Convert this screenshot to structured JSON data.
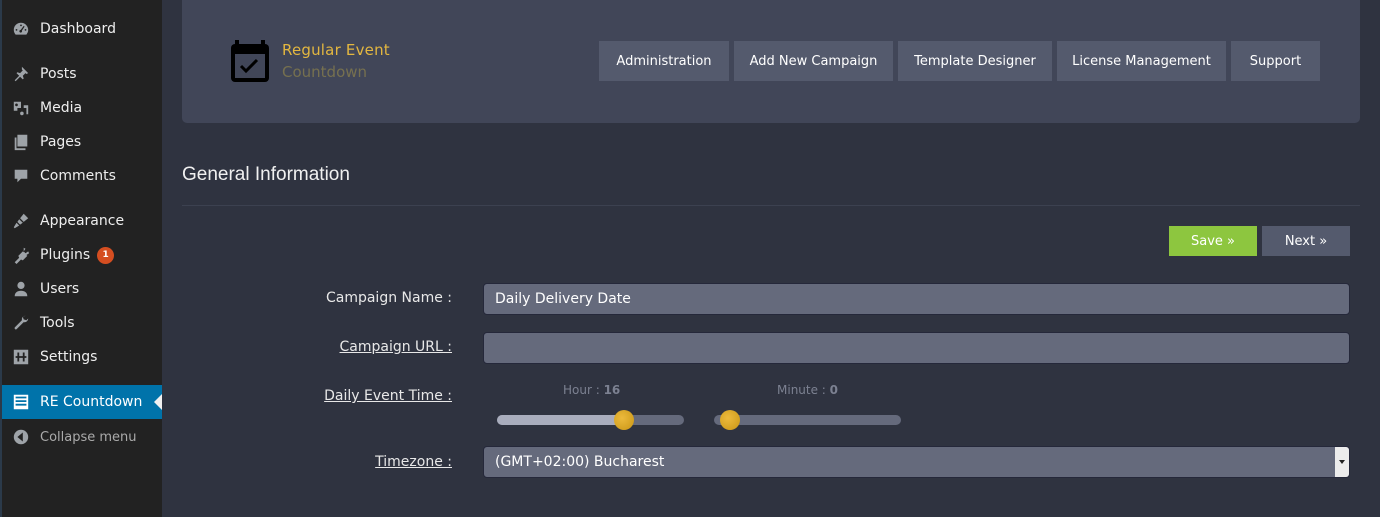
{
  "sidebar": {
    "items": [
      {
        "label": "Dashboard",
        "icon": "dashboard-icon"
      },
      {
        "label": "Posts",
        "icon": "pin-icon"
      },
      {
        "label": "Media",
        "icon": "media-icon"
      },
      {
        "label": "Pages",
        "icon": "pages-icon"
      },
      {
        "label": "Comments",
        "icon": "comment-icon"
      },
      {
        "label": "Appearance",
        "icon": "brush-icon"
      },
      {
        "label": "Plugins",
        "icon": "plug-icon",
        "badge": "1"
      },
      {
        "label": "Users",
        "icon": "user-icon"
      },
      {
        "label": "Tools",
        "icon": "wrench-icon"
      },
      {
        "label": "Settings",
        "icon": "settings-icon"
      },
      {
        "label": "RE Countdown",
        "icon": "list-icon",
        "active": true
      }
    ],
    "collapse_label": "Collapse menu"
  },
  "header": {
    "logo_title": "Regular Event",
    "logo_subtitle": "Countdown",
    "nav": [
      "Administration",
      "Add New Campaign",
      "Template Designer",
      "License Management",
      "Support"
    ]
  },
  "section": {
    "title": "General Information"
  },
  "actions": {
    "save": "Save »",
    "next": "Next »"
  },
  "form": {
    "campaign_name_label": "Campaign Name :",
    "campaign_name_value": "Daily Delivery Date",
    "campaign_url_label": "Campaign URL :",
    "campaign_url_value": "",
    "event_time_label": "Daily Event Time :",
    "hour_caption": "Hour : ",
    "hour_value": "16",
    "hour_fraction": 0.667,
    "minute_caption": "Minute : ",
    "minute_value": "0",
    "minute_fraction": 0.0,
    "timezone_label": "Timezone :",
    "timezone_value": "(GMT+02:00) Bucharest"
  },
  "colors": {
    "accent_gold": "#e3b740",
    "save_green": "#8dc63f",
    "wp_active_blue": "#0073aa",
    "badge_orange": "#d54e21"
  }
}
